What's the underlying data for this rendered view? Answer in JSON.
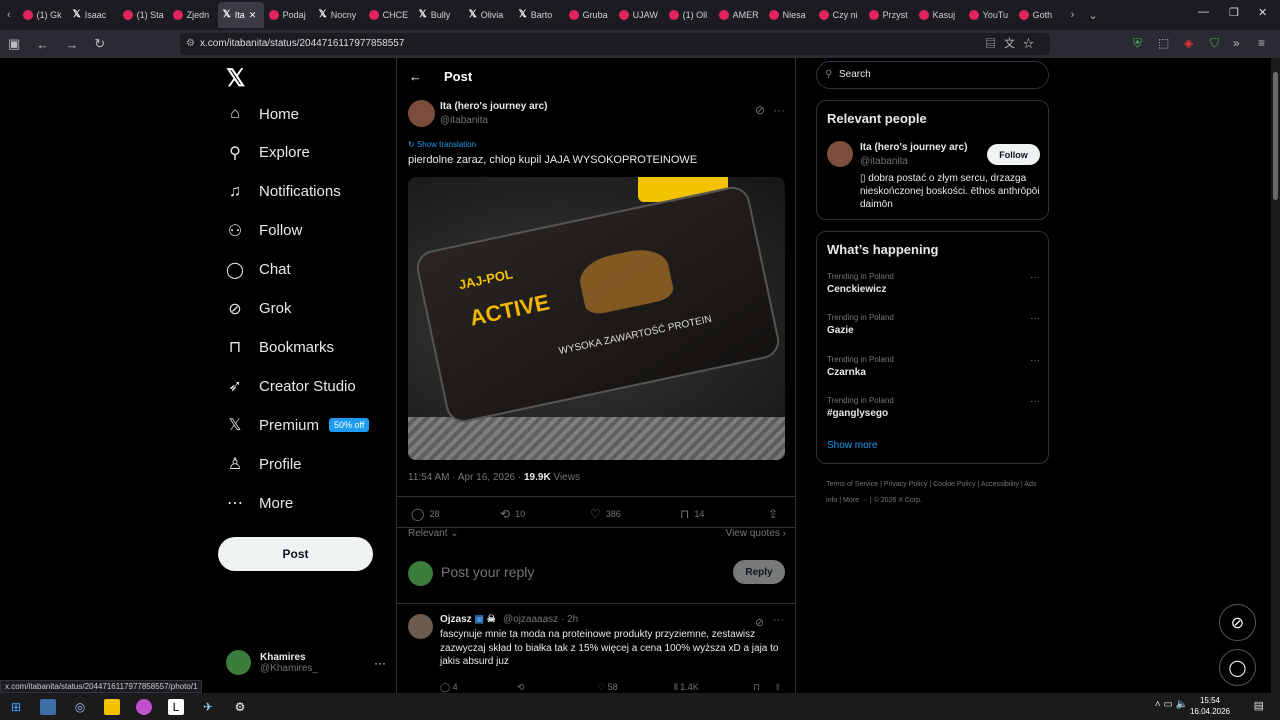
{
  "browser": {
    "tabs": [
      {
        "label": "(1) Gk",
        "icon": "youtube-icon"
      },
      {
        "label": "Isaac",
        "icon": "x-icon"
      },
      {
        "label": "(1) Sta",
        "icon": "youtube-icon"
      },
      {
        "label": "Zjedn",
        "icon": "youtube-icon"
      },
      {
        "label": "Ita",
        "icon": "x-icon",
        "active": true
      },
      {
        "label": "Podaj",
        "icon": "youtube-icon"
      },
      {
        "label": "Nocny",
        "icon": "x-icon"
      },
      {
        "label": "CHCE",
        "icon": "youtube-icon"
      },
      {
        "label": "Bully",
        "icon": "x-icon"
      },
      {
        "label": "Olivia",
        "icon": "x-icon"
      },
      {
        "label": "Barto",
        "icon": "x-icon"
      },
      {
        "label": "Gruba",
        "icon": "youtube-icon"
      },
      {
        "label": "UJAW",
        "icon": "youtube-icon"
      },
      {
        "label": "(1) Oll",
        "icon": "youtube-icon"
      },
      {
        "label": "AMER",
        "icon": "youtube-icon"
      },
      {
        "label": "Niesa",
        "icon": "youtube-icon"
      },
      {
        "label": "Czy ni",
        "icon": "youtube-icon"
      },
      {
        "label": "Przyst",
        "icon": "youtube-icon"
      },
      {
        "label": "Kasuj",
        "icon": "youtube-icon"
      },
      {
        "label": "YouTu",
        "icon": "youtube-icon"
      },
      {
        "label": "Goth",
        "icon": "youtube-icon"
      }
    ],
    "url": "x.com/itabanita/status/2044716117977858557",
    "status_url": "x.com/itabanita/status/2044716117977858557/photo/1"
  },
  "sidebar": {
    "items": [
      {
        "label": "Home",
        "icon": "home-icon"
      },
      {
        "label": "Explore",
        "icon": "search-icon"
      },
      {
        "label": "Notifications",
        "icon": "bell-icon"
      },
      {
        "label": "Follow",
        "icon": "person-plus-icon"
      },
      {
        "label": "Chat",
        "icon": "chat-icon"
      },
      {
        "label": "Grok",
        "icon": "grok-icon"
      },
      {
        "label": "Bookmarks",
        "icon": "bookmark-icon"
      },
      {
        "label": "Creator Studio",
        "icon": "rocket-icon"
      },
      {
        "label": "Premium",
        "icon": "x-icon",
        "badge": "50% off"
      },
      {
        "label": "Profile",
        "icon": "person-icon"
      },
      {
        "label": "More",
        "icon": "more-circle-icon"
      }
    ],
    "post_label": "Post",
    "account": {
      "name": "Khamires",
      "handle": "@Khamires_"
    }
  },
  "post": {
    "header_title": "Post",
    "author_name": "Ita (hero's journey arc)",
    "author_handle": "@itabanita",
    "show_translation": "Show translation",
    "text": "pierdolne zaraz, chlop kupil JAJA WYSOKOPROTEINOWE",
    "image": {
      "brand": "JAJ-POL",
      "title": "ACTIVE",
      "subtitle": "WYSOKA ZAWARTOŚĆ PROTEIN"
    },
    "time": "11:54 AM · Apr 16, 2026 · ",
    "views": "19.9K",
    "views_label": " Views",
    "replies": "28",
    "reposts": "10",
    "likes": "386",
    "bookmarks": "14",
    "sort_label": "Relevant",
    "view_quotes": "View quotes",
    "reply_placeholder": "Post your reply",
    "reply_button": "Reply"
  },
  "comment": {
    "name": "Ojzasz",
    "handle": "@ojzaaaasz · 2h",
    "text": "fascynuje mnie ta moda na proteinowe produkty przyziemne, zestawisz zazwyczaj skład to białka tak z 15% więcej a cena 100% wyższa xD a jaja to jakis absurd juz",
    "replies": "4",
    "likes": "58",
    "views": "1.4K"
  },
  "right": {
    "search_placeholder": "Search",
    "relevant_title": "Relevant people",
    "person_name": "Ita (hero's journey arc)",
    "person_handle": "@itabanita",
    "follow_label": "Follow",
    "person_bio": "dobra postać o złym sercu, drzazga nieskończonej boskości. ēthos anthrōpōi daimōn",
    "happening_title": "What’s happening",
    "trends": [
      {
        "context": "Trending in Poland",
        "name": "Cenckiewicz"
      },
      {
        "context": "Trending in Poland",
        "name": "Gazie"
      },
      {
        "context": "Trending in Poland",
        "name": "Czarnka"
      },
      {
        "context": "Trending in Poland",
        "name": "#ganglysego"
      }
    ],
    "show_more": "Show more",
    "footer": [
      "Terms of Service",
      "Privacy Policy",
      "Cookie Policy",
      "Accessibility",
      "Ads info",
      "More ···",
      "© 2026 X Corp."
    ]
  },
  "taskbar": {
    "time": "15:54",
    "date": "16.04.2026"
  }
}
